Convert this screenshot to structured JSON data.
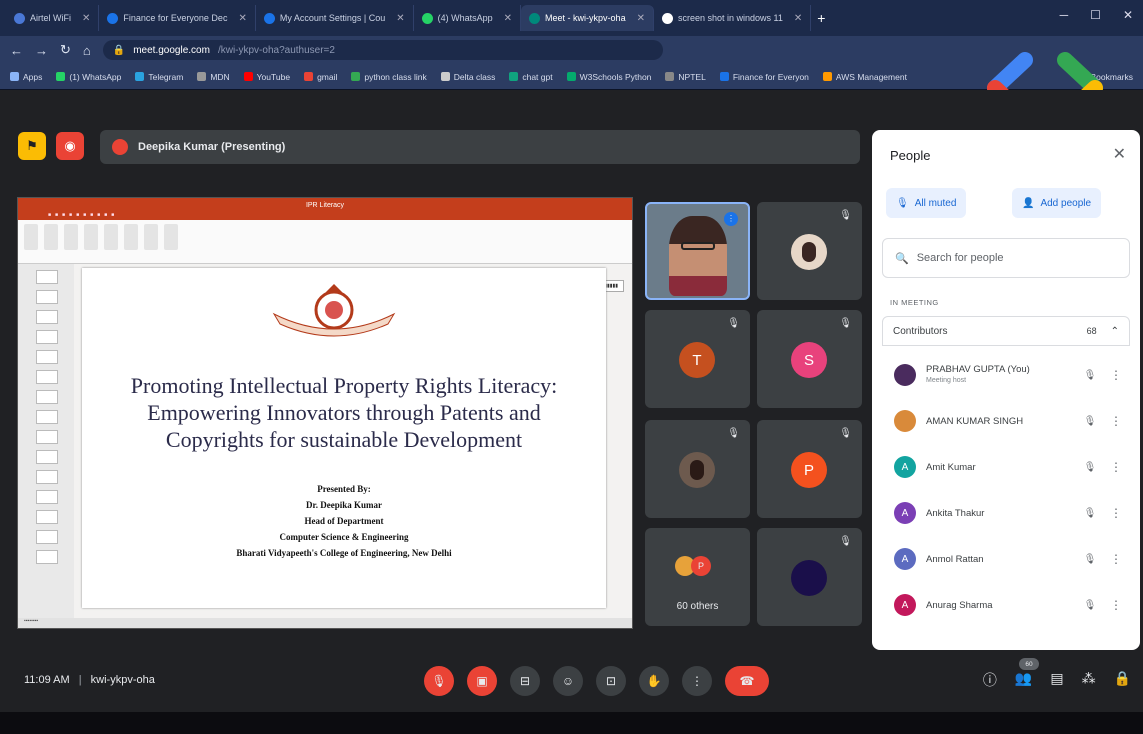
{
  "browser": {
    "tabs": [
      {
        "label": "Airtel WiFi",
        "color": "#4a78d6"
      },
      {
        "label": "Finance for Everyone Dec",
        "color": "#1a73e8"
      },
      {
        "label": "My Account Settings | Cou",
        "color": "#1a73e8"
      },
      {
        "label": "(4) WhatsApp",
        "color": "#25d366"
      },
      {
        "label": "Meet - kwi-ykpv-oha",
        "color": "#00897b",
        "active": true
      },
      {
        "label": "screen shot in windows 11",
        "color": "#ffffff"
      }
    ],
    "new_tab": "+",
    "url_host": "meet.google.com",
    "url_path": "/kwi-ykpv-oha?authuser=2",
    "bookmarks": [
      {
        "label": "Apps",
        "color": "#8ab4f8"
      },
      {
        "label": "(1) WhatsApp",
        "color": "#25d366"
      },
      {
        "label": "Telegram",
        "color": "#2aa3e0"
      },
      {
        "label": "MDN",
        "color": "#999999"
      },
      {
        "label": "YouTube",
        "color": "#ff0000"
      },
      {
        "label": "gmail",
        "color": "#ea4335"
      },
      {
        "label": "python class link",
        "color": "#34a853"
      },
      {
        "label": "Delta class",
        "color": "#cccccc"
      },
      {
        "label": "chat gpt",
        "color": "#10a37f"
      },
      {
        "label": "W3Schools Python",
        "color": "#04aa6d"
      },
      {
        "label": "NPTEL",
        "color": "#888888"
      },
      {
        "label": "Finance for Everyon",
        "color": "#1a73e8"
      },
      {
        "label": "AWS Management",
        "color": "#ff9900"
      },
      {
        "label": "Bookmarks",
        "color": "#fbbc04"
      }
    ]
  },
  "meet": {
    "presenting_label": "Deepika Kumar (Presenting)",
    "time": "11:09 AM",
    "meeting_code": "kwi-ykpv-oha",
    "people_badge": "60",
    "others_label": "60 others",
    "tiles": [
      {
        "initial": "T",
        "color": "#c5501f"
      },
      {
        "initial": "S",
        "color": "#e8427c"
      },
      {
        "initial": "P",
        "color": "#f4511e"
      }
    ]
  },
  "slide": {
    "window_title": "IPR Literacy",
    "title_line1": "Promoting Intellectual Property Rights Literacy:",
    "title_line2": "Empowering Innovators through Patents and",
    "title_line3": "Copyrights for sustainable Development",
    "presented_by": "Presented By:",
    "presenter": "Dr. Deepika Kumar",
    "role": "Head of Department",
    "department": "Computer Science & Engineering",
    "college": "Bharati Vidyapeeth's College of Engineering, New Delhi"
  },
  "people_panel": {
    "title": "People",
    "all_muted": "All muted",
    "add_people": "Add people",
    "search_placeholder": "Search for people",
    "in_meeting": "IN MEETING",
    "contributors": "Contributors",
    "count": "68",
    "participants": [
      {
        "name": "PRABHAV GUPTA (You)",
        "sub": "Meeting host",
        "initial": "",
        "color": "#4a2b5e"
      },
      {
        "name": "AMAN KUMAR SINGH",
        "sub": "",
        "initial": "",
        "color": "#d98a3a"
      },
      {
        "name": "Amit Kumar",
        "sub": "",
        "initial": "A",
        "color": "#12a4a0"
      },
      {
        "name": "Ankita Thakur",
        "sub": "",
        "initial": "A",
        "color": "#7b3fb5"
      },
      {
        "name": "Anmol Rattan",
        "sub": "",
        "initial": "A",
        "color": "#5c6bc0"
      },
      {
        "name": "Anurag Sharma",
        "sub": "",
        "initial": "A",
        "color": "#c2185b"
      }
    ]
  }
}
